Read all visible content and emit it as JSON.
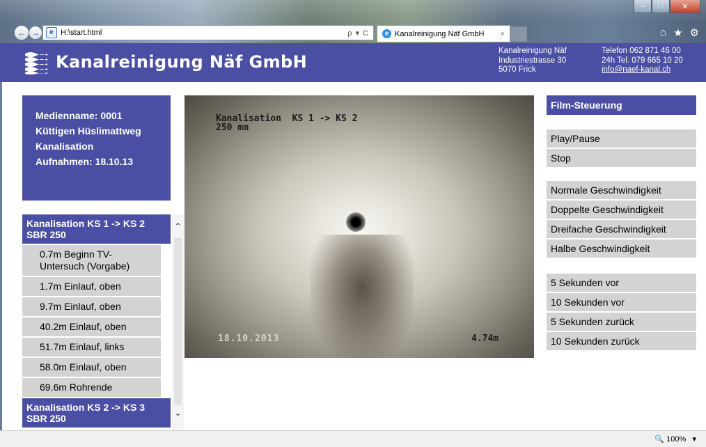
{
  "browser": {
    "address": "H:\\start.html",
    "address_tools": "ρ ▾ C",
    "tab_title": "Kanalreinigung Näf GmbH",
    "tab_close": "×",
    "zoom": "100%"
  },
  "header": {
    "title": "Kanalreinigung Näf GmbH",
    "address_lines": [
      "Kanalreinigung Näf",
      "Industriestrasse 30",
      "5070 Frick"
    ],
    "contact_lines": [
      "Telefon 062 871 46 00",
      "24h Tel. 079 665 10 20",
      "info@naef-kanal.ch"
    ]
  },
  "media_info": {
    "lines": [
      "Medienname: 0001",
      "Küttigen Hüslimattweg",
      "Kanalisation",
      "Aufnahmen: 18.10.13"
    ]
  },
  "sections": [
    {
      "title": "Kanalisation KS 1 -> KS 2 SBR 250",
      "items": [
        "0.7m Beginn TV-Untersuch (Vorgabe)",
        "1.7m Einlauf, oben",
        "9.7m Einlauf, oben",
        "40.2m Einlauf, oben",
        "51.7m Einlauf, links",
        "58.0m Einlauf, oben",
        "69.6m Rohrende"
      ]
    },
    {
      "title": "Kanalisation KS 2 -> KS 3 SBR 250",
      "items": []
    }
  ],
  "video": {
    "overlay_line1": "Kanalisation  KS 1 -> KS 2",
    "overlay_line2": "250 mm",
    "date": "18.10.2013",
    "distance": "4.74m"
  },
  "controls": {
    "title": "Film-Steuerung",
    "playback": [
      "Play/Pause",
      "Stop"
    ],
    "speed": [
      "Normale Geschwindigkeit",
      "Doppelte Geschwindigkeit",
      "Dreifache Geschwindigkeit",
      "Halbe Geschwindigkeit"
    ],
    "seek": [
      "5 Sekunden vor",
      "10 Sekunden vor",
      "5 Sekunden zurück",
      "10 Sekunden zurück"
    ]
  },
  "colors": {
    "brand": "#4a4fa3",
    "button_bg": "#d3d3d3"
  }
}
